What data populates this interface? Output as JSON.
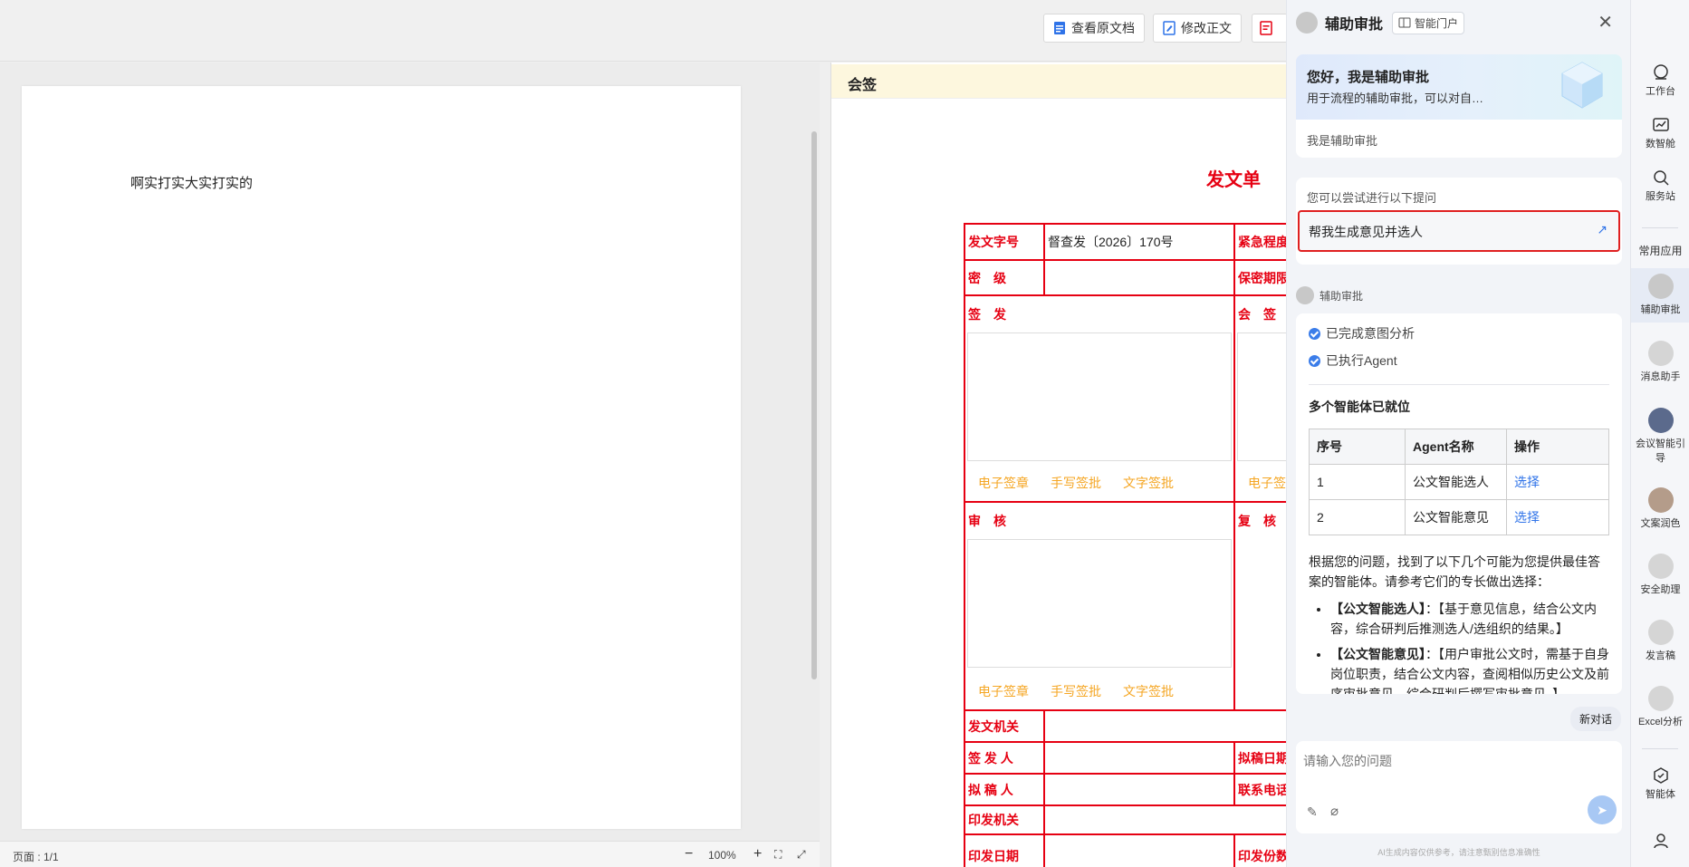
{
  "toolbar": {
    "view_original": "查看原文档",
    "edit_body": "修改正文"
  },
  "document": {
    "body_text": "啊实打实大实打实的",
    "page_indicator": "页面 : 1/1",
    "zoom": "100%"
  },
  "form": {
    "section_title": "会签",
    "title": "发文单",
    "doc_number_label": "发文字号",
    "doc_number_value": "督查发〔2026〕170号",
    "urgency_label": "紧急程度",
    "secrecy_label": "密　级",
    "secrecy_period_label": "保密期限",
    "sign_label": "签　发",
    "countersign_label": "会　签",
    "review_label": "审　核",
    "recheck_label": "复　核",
    "sig_links": [
      "电子签章",
      "手写签批",
      "文字签批"
    ],
    "issuer_org_label": "发文机关",
    "signer_label": "签 发 人",
    "draft_date_label": "拟稿日期",
    "drafter_label": "拟 稿 人",
    "contact_label": "联系电话",
    "print_org_label": "印发机关",
    "print_date_label": "印发日期",
    "print_copies_label": "印发份数"
  },
  "assistant": {
    "title": "辅助审批",
    "portal_button": "智能门户",
    "greeting_title": "您好，我是辅助审批",
    "greeting_desc": "用于流程的辅助审批，可以对自…",
    "intro": "我是辅助审批",
    "suggest_label": "您可以尝试进行以下提问",
    "suggest_item": "帮我生成意见并选人",
    "bot_name": "辅助审批",
    "steps": [
      "已完成意图分析",
      "已执行Agent"
    ],
    "ready_title": "多个智能体已就位",
    "table_headers": [
      "序号",
      "Agent名称",
      "操作"
    ],
    "table_rows": [
      {
        "no": "1",
        "name": "公文智能选人",
        "action": "选择"
      },
      {
        "no": "2",
        "name": "公文智能意见",
        "action": "选择"
      }
    ],
    "answer_intro": "根据您的问题，找到了以下几个可能为您提供最佳答案的智能体。请参考它们的专长做出选择：",
    "bullets": [
      {
        "name": "【公文智能选人】",
        "desc": "：【基于意见信息，结合公文内容，综合研判后推测选人/选组织的结果。】"
      },
      {
        "name": "【公文智能意见】",
        "desc": "：【用户审批公文时，需基于自身岗位职责，结合公文内容，查阅相似历史公文及前序审批意见，综合研判后撰写审批意见。】"
      }
    ],
    "new_chat": "新对话",
    "input_placeholder": "请输入您的问题",
    "disclaimer": "AI生成内容仅供参考，请注意甄别信息准确性"
  },
  "rail": {
    "items": [
      "工作台",
      "数智舱",
      "服务站"
    ],
    "common_apps_label": "常用应用",
    "apps": [
      "辅助审批",
      "消息助手",
      "会议智能引导",
      "文案润色",
      "安全助理",
      "发言稿",
      "Excel分析"
    ],
    "agents_label": "智能体"
  },
  "colors": {
    "form_red": "#e60012",
    "sig_orange": "#f5a623",
    "link_blue": "#2f73e8",
    "highlight_border": "#e02020"
  }
}
